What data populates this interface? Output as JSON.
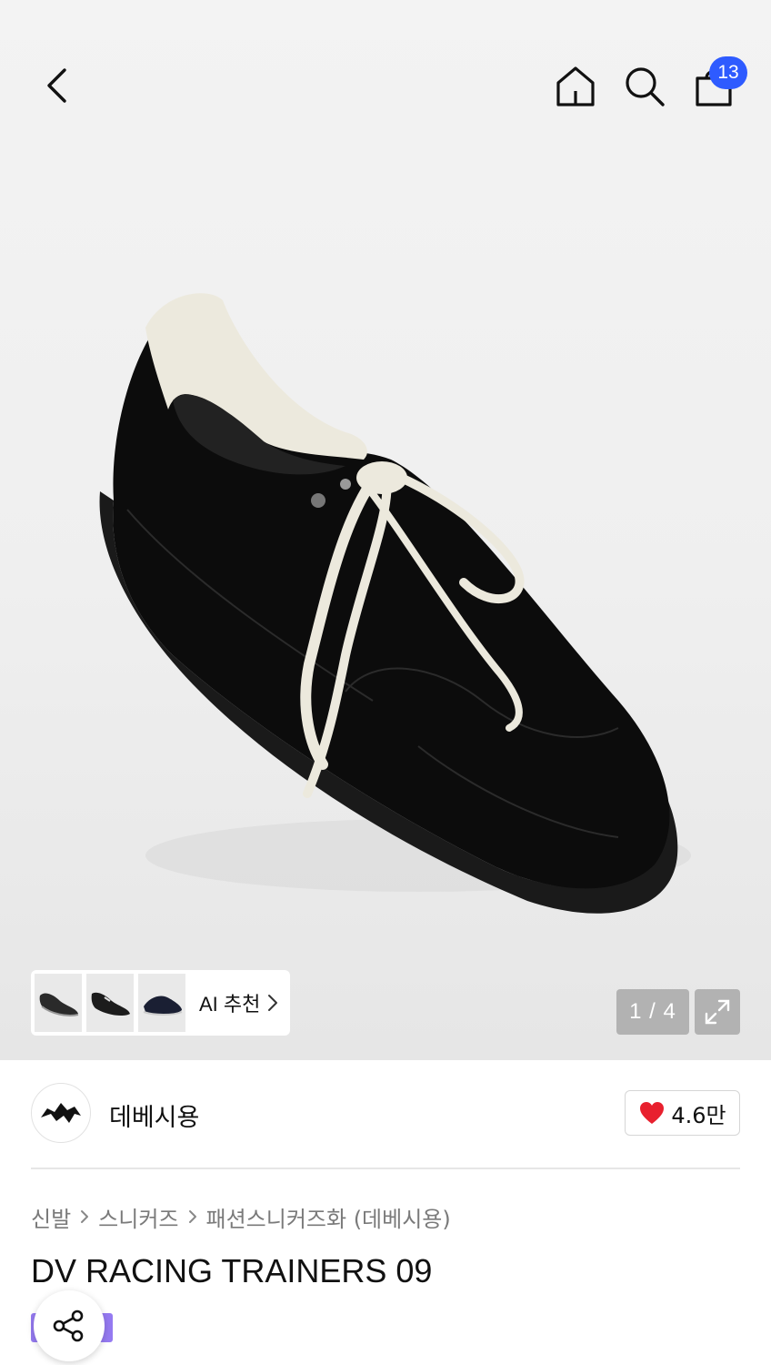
{
  "header": {
    "back_icon": "chevron-left-icon",
    "home_icon": "home-icon",
    "search_icon": "search-icon",
    "cart_icon": "shopping-bag-icon",
    "cart_count": "13",
    "badge_color": "#2e5bff"
  },
  "gallery": {
    "ai_recommend_label": "AI 추천",
    "pager": "1 / 4",
    "expand_icon": "expand-icon"
  },
  "brand": {
    "name": "데베시용",
    "like_count": "4.6만",
    "heart_color": "#e8202e"
  },
  "breadcrumb": {
    "items": [
      "신발",
      "스니커즈",
      "패션스니커즈화 (데베시용)"
    ]
  },
  "product": {
    "title": "DV RACING TRAINERS 09"
  },
  "actions": {
    "share_icon": "share-icon"
  }
}
